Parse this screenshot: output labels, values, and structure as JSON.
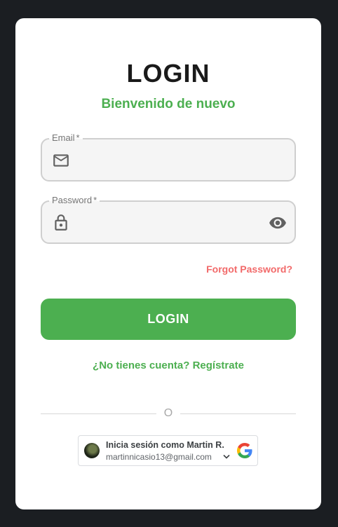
{
  "login": {
    "title": "LOGIN",
    "subtitle": "Bienvenido de nuevo",
    "email": {
      "label": "Email",
      "required_mark": "*",
      "icon": "mail-icon",
      "value": ""
    },
    "password": {
      "label": "Password",
      "required_mark": "*",
      "icon": "lock-icon",
      "toggle_icon": "eye-icon",
      "value": ""
    },
    "forgot_password": "Forgot Password?",
    "submit_label": "LOGIN",
    "register_link": "¿No tienes cuenta? Regístrate",
    "divider_text": "O"
  },
  "google_signin": {
    "title": "Inicia sesión como Martin R.",
    "email": "martinnicasio13@gmail.com",
    "icon": "google-icon"
  },
  "colors": {
    "accent": "#4caf50",
    "forgot": "#f26a6a",
    "background": "#1b1e22",
    "card": "#ffffff"
  }
}
